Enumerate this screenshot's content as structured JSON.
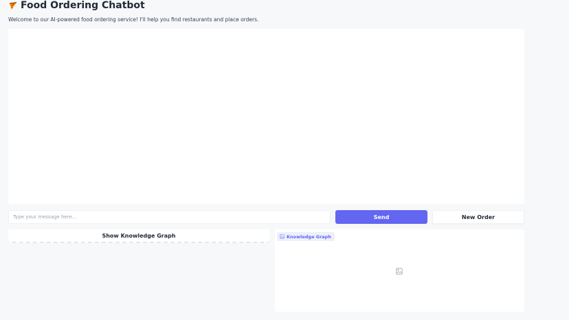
{
  "header": {
    "title": "Food Ordering Chatbot",
    "icon": "pizza-icon"
  },
  "subtitle": "Welcome to our AI-powered food ordering service! I'll help you find restaurants and place orders.",
  "chat_input": {
    "placeholder": "Type your message here...",
    "value": ""
  },
  "buttons": {
    "send": "Send",
    "new_order": "New Order",
    "show_knowledge_graph": "Show Knowledge Graph"
  },
  "knowledge_graph_panel": {
    "label": "Knowledge Graph",
    "label_icon": "image-icon",
    "placeholder_icon": "image-placeholder-icon"
  },
  "colors": {
    "accent": "#6366f1",
    "background": "#f7f8fa",
    "panel": "#ffffff",
    "label_background": "#eef0fb"
  }
}
